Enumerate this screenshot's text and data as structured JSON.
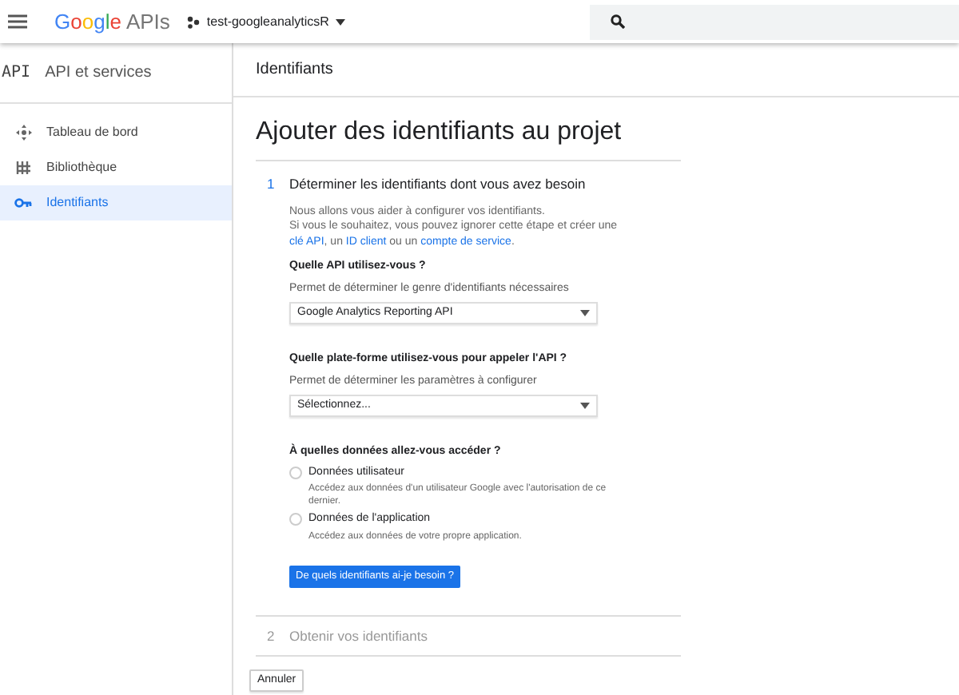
{
  "topbar": {
    "logo_brand": "Google",
    "logo_product": "APIs",
    "project": "test-googleanalyticsR"
  },
  "sidebar": {
    "badge": "API",
    "title": "API et services",
    "items": [
      {
        "label": "Tableau de bord",
        "selected": false
      },
      {
        "label": "Bibliothèque",
        "selected": false
      },
      {
        "label": "Identifiants",
        "selected": true
      }
    ]
  },
  "page_header": "Identifiants",
  "title": "Ajouter des identifiants au projet",
  "steps": [
    {
      "number": "1",
      "title": "Déterminer les identifiants dont vous avez besoin",
      "active": true
    },
    {
      "number": "2",
      "title": "Obtenir vos identifiants",
      "active": false
    }
  ],
  "intro": {
    "line1": "Nous allons vous aider à configurer vos identifiants.",
    "line2": "Si vous le souhaitez, vous pouvez ignorer cette étape et créer une",
    "link1": "clé API",
    "sep1": ", un ",
    "link2": "ID client",
    "sep2": " ou un ",
    "link3": "compte de service",
    "end": "."
  },
  "questions": [
    {
      "kind": "select",
      "label": "Quelle API utilisez-vous ?",
      "hint": "Permet de déterminer le genre d'identifiants nécessaires",
      "value": "Google Analytics Reporting API"
    },
    {
      "kind": "select",
      "label": "Quelle plate-forme utilisez-vous pour appeler l'API ?",
      "hint": "Permet de déterminer les paramètres à configurer",
      "value": "Sélectionnez..."
    },
    {
      "kind": "radio",
      "label": "À quelles données allez-vous accéder ?",
      "options": [
        {
          "label": "Données utilisateur",
          "description": "Accédez aux données d'un utilisateur Google avec l'autorisation de ce dernier.",
          "selected": false
        },
        {
          "label": "Données de l'application",
          "description": "Accédez aux données de votre propre application.",
          "selected": false
        }
      ]
    }
  ],
  "primary_button": "De quels identifiants ai-je besoin ?",
  "cancel_button": "Annuler"
}
